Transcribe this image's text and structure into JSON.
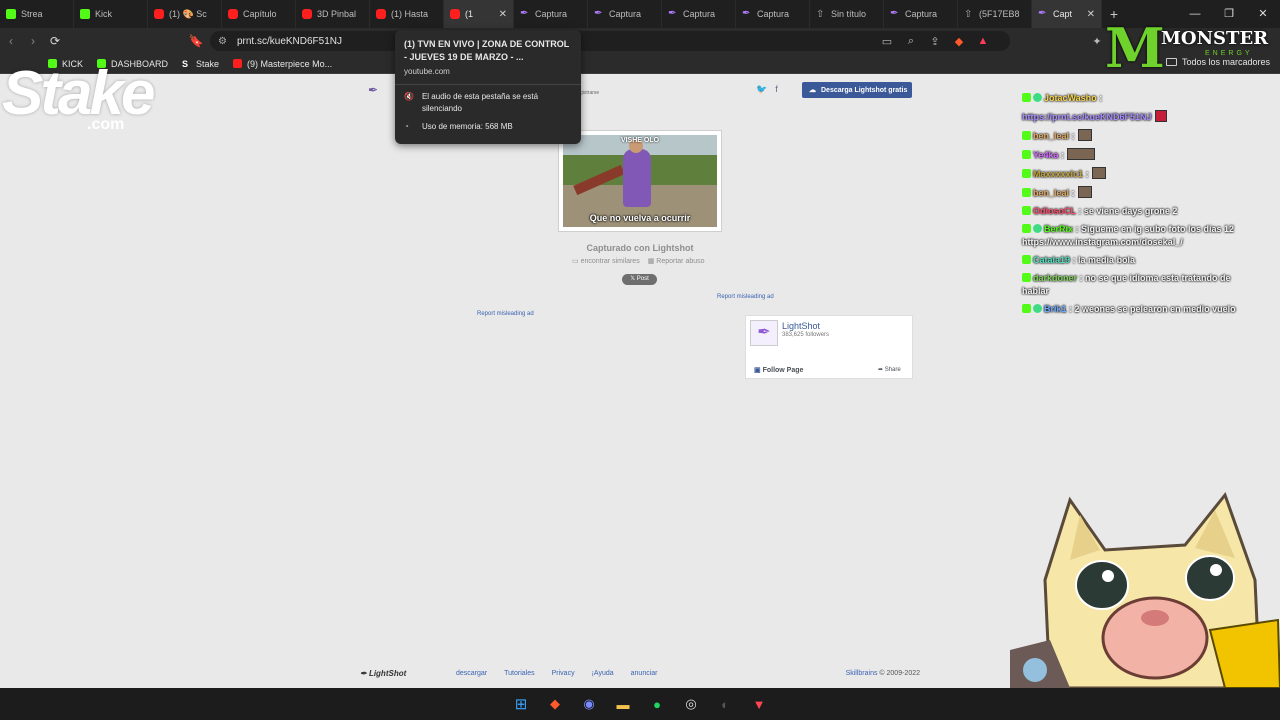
{
  "tabs": [
    {
      "label": "Strea",
      "icon": "kick"
    },
    {
      "label": "Kick",
      "icon": "kick"
    },
    {
      "label": "(1) 🎨 Sc",
      "icon": "yt"
    },
    {
      "label": "Capítulo",
      "icon": "yt"
    },
    {
      "label": "3D Pinbal",
      "icon": "yt"
    },
    {
      "label": "(1) Hasta",
      "icon": "yt"
    },
    {
      "label": "(1",
      "icon": "yt",
      "active": true
    },
    {
      "label": "Captura",
      "icon": "pen"
    },
    {
      "label": "Captura",
      "icon": "pen"
    },
    {
      "label": "Captura",
      "icon": "pen"
    },
    {
      "label": "Captura",
      "icon": "pen"
    },
    {
      "label": "Sin título",
      "icon": "gen"
    },
    {
      "label": "Captura",
      "icon": "pen"
    },
    {
      "label": "(5F17EB8",
      "icon": "gen"
    },
    {
      "label": "Capt",
      "icon": "pen",
      "active2": true
    }
  ],
  "address": {
    "url": "prnt.sc/kueKND6F51NJ"
  },
  "bookmarks": [
    {
      "label": "KICK",
      "icon": "kick"
    },
    {
      "label": "DASHBOARD",
      "icon": "kick"
    },
    {
      "label": "Stake",
      "icon": "stk"
    },
    {
      "label": "(9) Masterpiece Mo...",
      "icon": "yt"
    }
  ],
  "all_bookmarks": "Todos los marcadores",
  "tooltip": {
    "title": "(1) TVN EN VIVO | ZONA DE CONTROL - JUEVES 19 DE MARZO - ...",
    "domain": "youtube.com",
    "muted": "El audio de esta pestaña se está silenciando",
    "memory": "Uso de memoria: 568 MB"
  },
  "lightshot": {
    "download_btn": "Descarga Lightshot gratis",
    "signup_hint": "gistrarse",
    "caption_top": "VISHE OLO",
    "caption_bottom": "Que no vuelva a ocurrir",
    "captured": "Capturado con Lightshot",
    "similar": "encontrar similares",
    "report_abuse": "Reportar abuso",
    "post": "𝕏 Post",
    "report1": "Report misleading ad",
    "report2": "Report misleading ad"
  },
  "facebook": {
    "name": "LightShot",
    "followers": "383,625 followers",
    "follow": "Follow Page",
    "share": "Share"
  },
  "footer": {
    "logo": "LightShot",
    "links": [
      "descargar",
      "Tutoriales",
      "Privacy",
      "¡Ayuda",
      "anunciar"
    ],
    "brand": "Skillbrains",
    "copyright": "© 2009-2022"
  },
  "overlays": {
    "stake_word": "Stake",
    "stake_com": ".com",
    "monster_word": "MONSTER",
    "monster_energy": "ENERGY"
  },
  "chat": [
    {
      "user": "JotacWasho",
      "color": "#f5d34a",
      "text": ":"
    },
    {
      "user": "",
      "color": "#a88cff",
      "text": "https://prnt.sc/kueKND6F51NJ"
    },
    {
      "user": "ben_leal",
      "color": "#e0a860",
      "text": ":"
    },
    {
      "user": "Ye4ka",
      "color": "#d46cff",
      "text": ":"
    },
    {
      "user": "Maxxxxxic1",
      "color": "#c4a53a",
      "text": ":"
    },
    {
      "user": "ben_leal",
      "color": "#e0a860",
      "text": ":"
    },
    {
      "user": "OdiosoCL",
      "color": "#ff4d6d",
      "text": ": se viene days grone 2"
    },
    {
      "user": "BerRix",
      "color": "#53fc18",
      "text": ": Sígueme en ig subo foto los días 12 https://www.instagram.com/dosekal_/"
    },
    {
      "user": "Catala19",
      "color": "#53e0c0",
      "text": ": la media bola"
    },
    {
      "user": "darkdoner",
      "color": "#7fd35a",
      "text": ": no se que idioma esta tratando de hablar"
    },
    {
      "user": "Brik1",
      "color": "#6aa9ff",
      "text": ": 2 weones se pelearon en medio vuelo"
    }
  ]
}
